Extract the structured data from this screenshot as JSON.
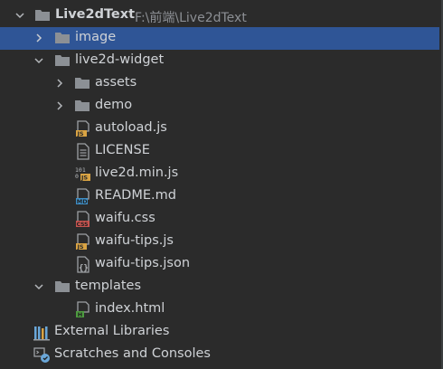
{
  "project": {
    "name": "Live2dText",
    "path": "F:\\前端\\Live2dText"
  },
  "tree": [
    {
      "label": "image",
      "kind": "folder",
      "expanded": false,
      "selected": true
    },
    {
      "label": "live2d-widget",
      "kind": "folder",
      "expanded": true
    },
    {
      "label": "assets",
      "kind": "folder",
      "expanded": false
    },
    {
      "label": "demo",
      "kind": "folder",
      "expanded": false
    },
    {
      "label": "autoload.js",
      "kind": "js-file",
      "badge": "JS"
    },
    {
      "label": "LICENSE",
      "kind": "text-file"
    },
    {
      "label": "live2d.min.js",
      "kind": "minjs-file",
      "badge": "JS"
    },
    {
      "label": "README.md",
      "kind": "md-file",
      "badge": "MD"
    },
    {
      "label": "waifu.css",
      "kind": "css-file",
      "badge": "CSS"
    },
    {
      "label": "waifu-tips.js",
      "kind": "js-file",
      "badge": "JS"
    },
    {
      "label": "waifu-tips.json",
      "kind": "json-file"
    },
    {
      "label": "templates",
      "kind": "folder",
      "expanded": true
    },
    {
      "label": "index.html",
      "kind": "html-file",
      "badge": "H"
    }
  ],
  "footer": {
    "libraries": "External Libraries",
    "scratches": "Scratches and Consoles"
  },
  "colors": {
    "background": "#2b2b2b",
    "selection": "#2f5596",
    "folder": "#8c9095",
    "js_badge": "#d9a343",
    "md_badge": "#3f8fc7",
    "css_badge": "#c75450",
    "html_badge": "#4d9a3f"
  }
}
